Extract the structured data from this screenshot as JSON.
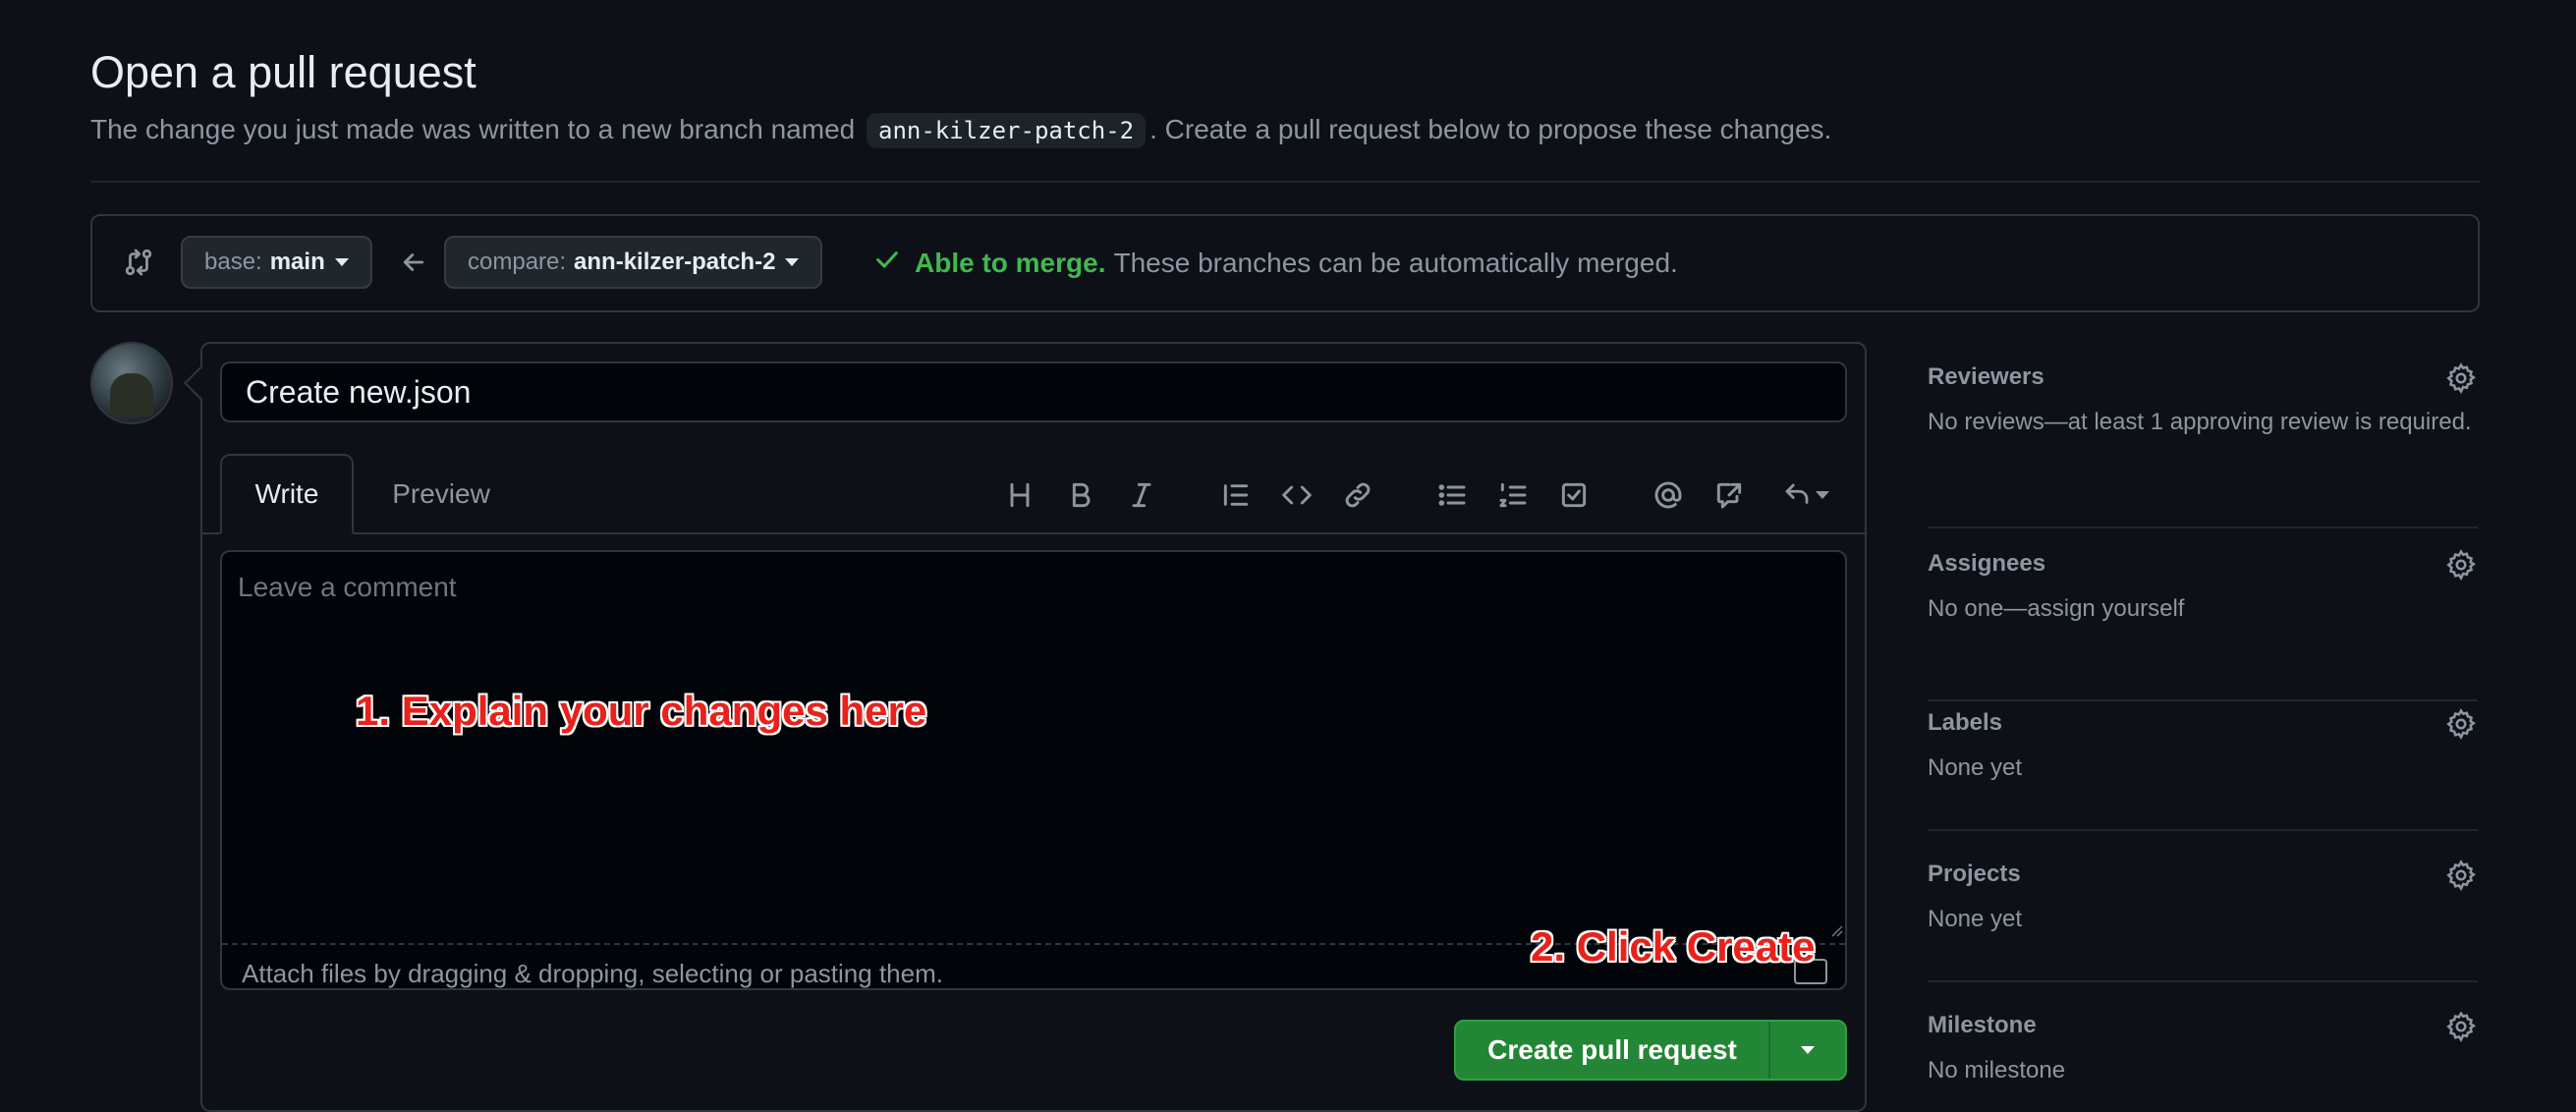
{
  "header": {
    "title": "Open a pull request",
    "subtitle_pre": "The change you just made was written to a new branch named",
    "branch": "ann-kilzer-patch-2",
    "subtitle_post": ". Create a pull request below to propose these changes."
  },
  "compare": {
    "base_label": "base:",
    "base_value": "main",
    "compare_label": "compare:",
    "compare_value": "ann-kilzer-patch-2",
    "merge_ok": "Able to merge.",
    "merge_msg": "These branches can be automatically merged."
  },
  "editor": {
    "title_value": "Create new.json",
    "tab_write": "Write",
    "tab_preview": "Preview",
    "comment_placeholder": "Leave a comment",
    "attach_text": "Attach files by dragging & dropping, selecting or pasting them.",
    "toolbar": [
      "heading-icon",
      "bold-icon",
      "italic-icon",
      "quote-icon",
      "code-icon",
      "link-icon",
      "bullet-list-icon",
      "numbered-list-icon",
      "task-list-icon",
      "mention-icon",
      "reference-icon",
      "reply-icon"
    ]
  },
  "annotations": {
    "step1": "1. Explain your changes here",
    "step2": "2. Click Create"
  },
  "actions": {
    "create_label": "Create pull request"
  },
  "sidebar": {
    "reviewers_title": "Reviewers",
    "reviewers_body": "No reviews—at least 1 approving review is required.",
    "assignees_title": "Assignees",
    "assignees_body": "No one—assign yourself",
    "labels_title": "Labels",
    "labels_body": "None yet",
    "projects_title": "Projects",
    "projects_body": "None yet",
    "milestone_title": "Milestone",
    "milestone_body": "No milestone"
  },
  "colors": {
    "background": "#0d1117",
    "accent_green": "#238636",
    "merge_green": "#3fb950",
    "annotation_red": "#e8221b"
  }
}
